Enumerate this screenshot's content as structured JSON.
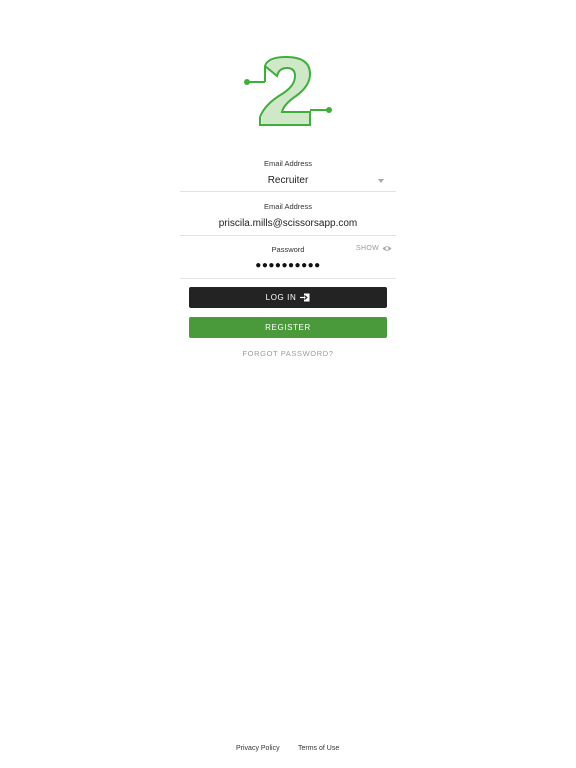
{
  "role": {
    "label": "Email Address",
    "value": "Recruiter"
  },
  "email": {
    "label": "Email Address",
    "value": "priscila.mills@scissorsapp.com"
  },
  "password": {
    "label": "Password",
    "masked_value": "●●●●●●●●●●",
    "show_label": "SHOW"
  },
  "buttons": {
    "login_label": "LOG IN",
    "register_label": "REGISTER"
  },
  "forgot_password": "FORGOT PASSWORD?",
  "footer": {
    "privacy": "Privacy Policy",
    "terms": "Terms of Use"
  },
  "colors": {
    "brand_green": "#4a9a3c",
    "logo_stroke": "#3fae3a",
    "logo_fill": "#cfe8c8",
    "login_bg": "#232323"
  },
  "icons": {
    "logo": "number-two-logo",
    "caret": "chevron-down-icon",
    "eye": "eye-icon",
    "login": "log-in-icon"
  }
}
